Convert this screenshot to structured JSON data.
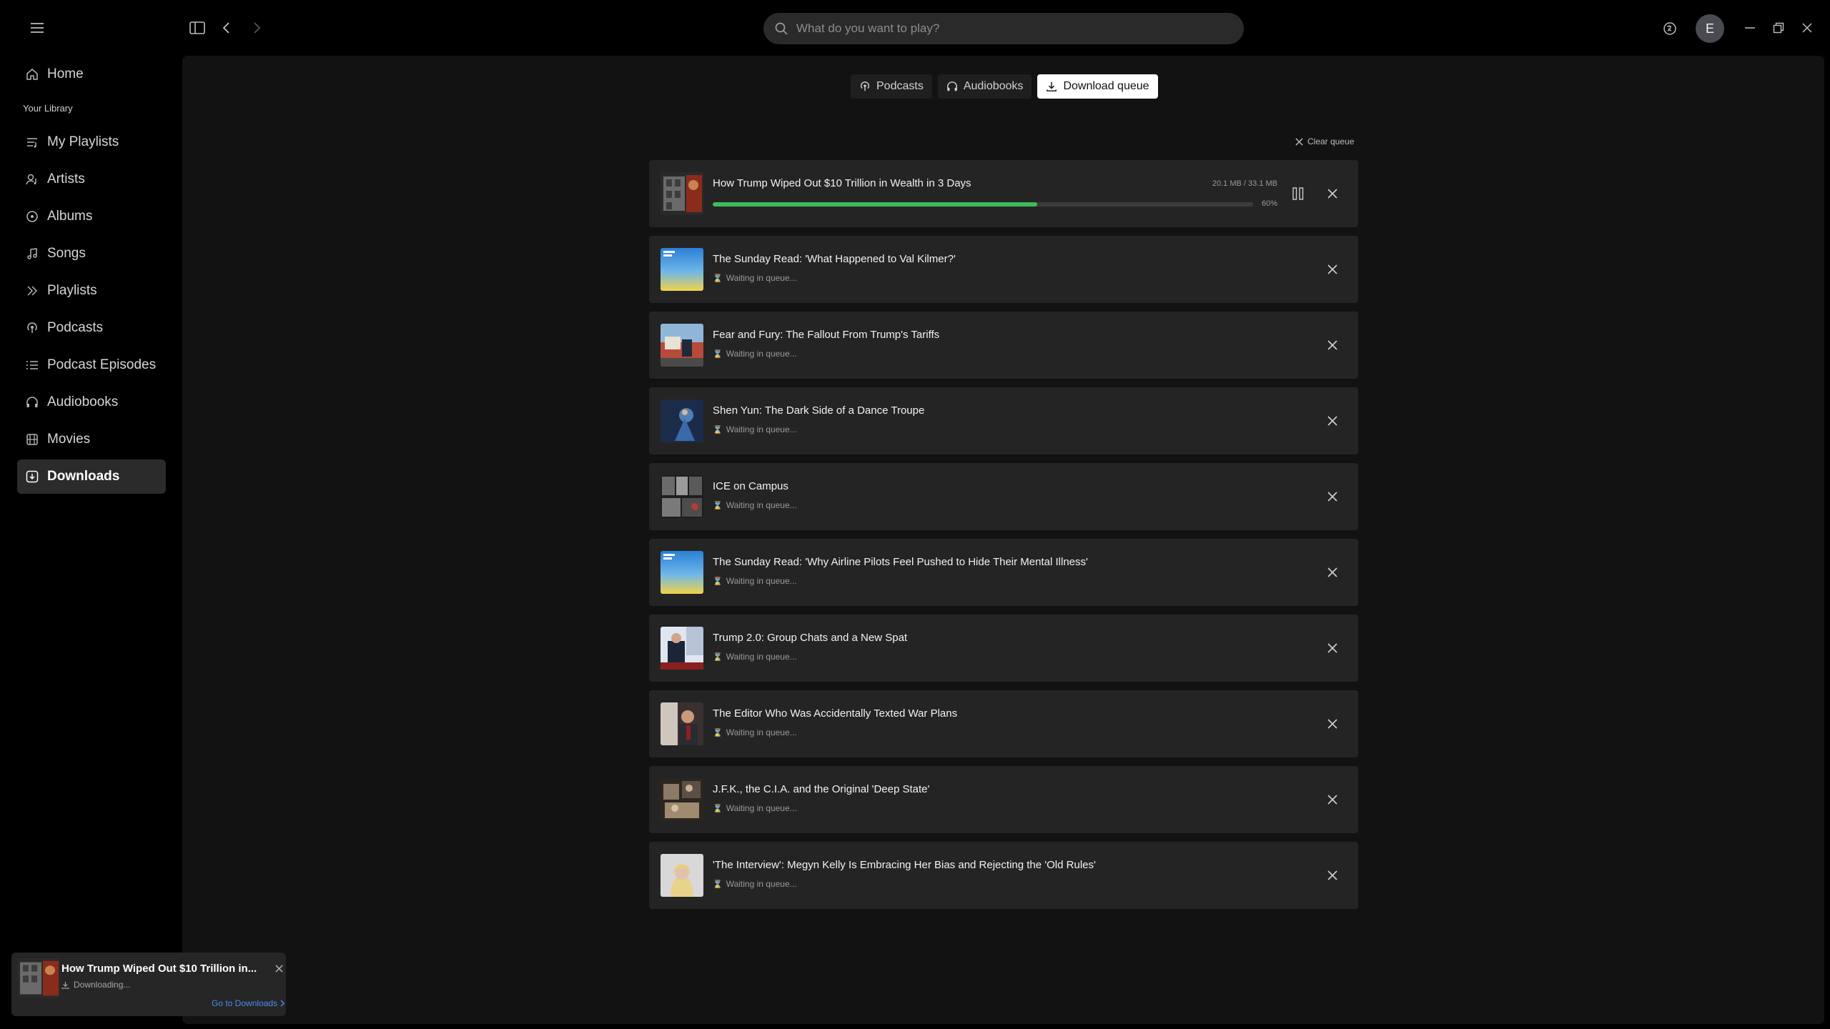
{
  "search": {
    "placeholder": "What do you want to play?"
  },
  "user": {
    "avatar_initial": "E"
  },
  "sidebar": {
    "library_heading": "Your Library",
    "items": [
      {
        "label": "Home",
        "icon": "home-icon"
      },
      {
        "label": "My Playlists",
        "icon": "playlist-icon"
      },
      {
        "label": "Artists",
        "icon": "artist-icon"
      },
      {
        "label": "Albums",
        "icon": "album-icon"
      },
      {
        "label": "Songs",
        "icon": "music-note-icon"
      },
      {
        "label": "Playlists",
        "icon": "playlists-icon"
      },
      {
        "label": "Podcasts",
        "icon": "podcast-icon"
      },
      {
        "label": "Podcast Episodes",
        "icon": "list-icon"
      },
      {
        "label": "Audiobooks",
        "icon": "headphones-icon"
      },
      {
        "label": "Movies",
        "icon": "film-icon"
      },
      {
        "label": "Downloads",
        "icon": "download-icon",
        "active": true
      }
    ]
  },
  "tabs": [
    {
      "label": "Podcasts",
      "icon": "podcast-icon"
    },
    {
      "label": "Audiobooks",
      "icon": "headphones-icon"
    },
    {
      "label": "Download queue",
      "icon": "download-icon",
      "active": true
    }
  ],
  "queue": {
    "clear_label": "Clear queue",
    "active": {
      "title": "How Trump Wiped Out $10 Trillion in Wealth in 3 Days",
      "size": "20.1 MB / 33.1 MB",
      "progress_text": "60%",
      "progress": 0.6
    },
    "waiting_label": "Waiting in queue...",
    "items": [
      {
        "title": "The Sunday Read: 'What Happened to Val Kilmer?'",
        "art": "the-daily"
      },
      {
        "title": "Fear and Fury: The Fallout From Trump's Tariffs",
        "art": "tariffs"
      },
      {
        "title": "Shen Yun: The Dark Side of a Dance Troupe",
        "art": "shenyun"
      },
      {
        "title": "ICE on Campus",
        "art": "ice"
      },
      {
        "title": "The Sunday Read: 'Why Airline Pilots Feel Pushed to Hide Their Mental Illness'",
        "art": "the-daily"
      },
      {
        "title": "Trump 2.0: Group Chats and a New Spat",
        "art": "trump2"
      },
      {
        "title": "The Editor Who Was Accidentally Texted War Plans",
        "art": "editor"
      },
      {
        "title": "J.F.K., the C.I.A. and the Original 'Deep State'",
        "art": "jfk"
      },
      {
        "title": "'The Interview': Megyn Kelly Is Embracing Her Bias and Rejecting the 'Old Rules'",
        "art": "interview"
      }
    ]
  },
  "toast": {
    "title": "How Trump Wiped Out $10 Trillion in...",
    "status": "Downloading...",
    "link": "Go to Downloads"
  },
  "colors": {
    "accent_green": "#3fbb5a",
    "link_blue": "#4c8cf0",
    "hourglass": "#e0a44a"
  }
}
